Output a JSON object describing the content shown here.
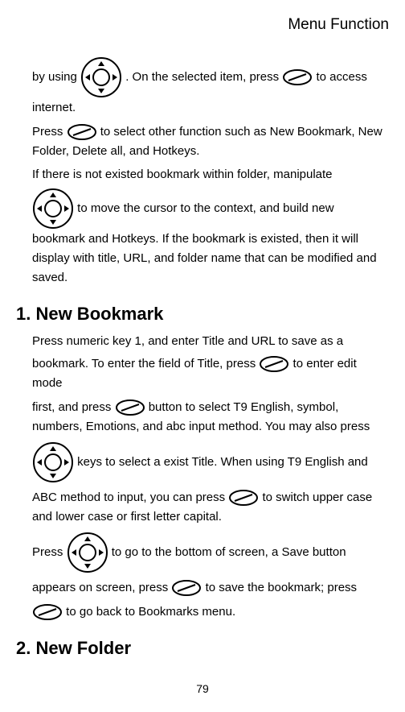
{
  "header": {
    "title": "Menu Function"
  },
  "body": {
    "para1_part1": "by using  ",
    "para1_part2": ".    On the selected item, press  ",
    "para1_part3": "  to access internet.",
    "para2_part1": "Press  ",
    "para2_part2": "  to select other function such as New Bookmark, New Folder, Delete all, and Hotkeys.",
    "para3": "If there is not existed bookmark within folder, manipulate",
    "para4": "  to move the cursor to the context, and build new bookmark and Hotkeys.    If the bookmark is existed, then it will display with title, URL, and folder name that can be modified and saved."
  },
  "section1": {
    "heading": "1. New Bookmark",
    "para1": "Press numeric key 1, and enter Title and URL to save as a",
    "para2_part1": "bookmark. To enter the field of Title, press  ",
    "para2_part2": " to enter edit mode",
    "para3_part1": "first, and press ",
    "para3_part2": "  button to select T9 English, symbol, numbers, Emotions, and abc input method. You may also press",
    "para4": " keys to select a exist Title.    When using T9 English and",
    "para5_part1": "ABC method to input, you can press  ",
    "para5_part2": "  to switch upper case and lower case or first letter capital.",
    "para6_part1": "Press ",
    "para6_part2": " to go to the bottom of screen, a Save button",
    "para7_part1": "appears on screen, press  ",
    "para7_part2": " to save the bookmark; press",
    "para8": "  to go back to Bookmarks menu."
  },
  "section2": {
    "heading": "2. New Folder"
  },
  "footer": {
    "page_number": "79"
  }
}
